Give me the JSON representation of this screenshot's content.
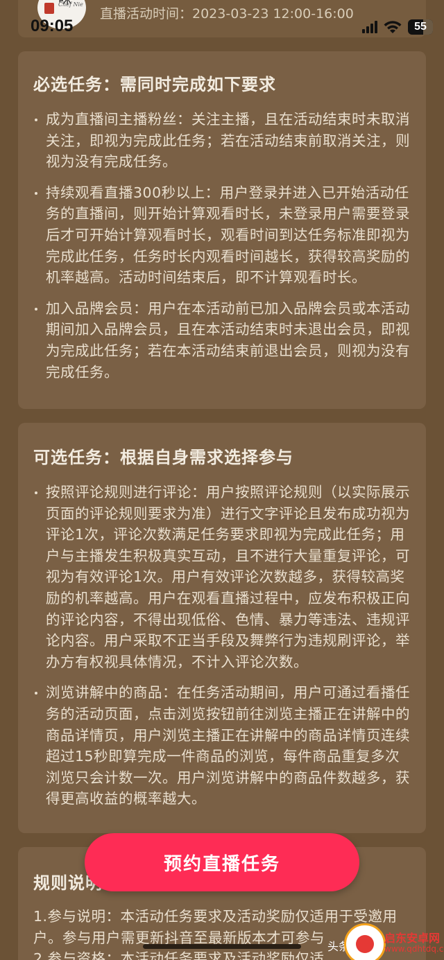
{
  "status_bar": {
    "time": "09:05",
    "battery": "55"
  },
  "header": {
    "avatar_logo_text": "Chef Nie",
    "live_time": "直播活动时间：2023-03-23 12:00-16:00"
  },
  "sections": [
    {
      "title": "必选任务：需同时完成如下要求",
      "items": [
        "成为直播间主播粉丝：关注主播，且在活动结束时未取消关注，即视为完成此任务；若在活动结束前取消关注，则视为没有完成任务。",
        "持续观看直播300秒以上：用户登录并进入已开始活动任务的直播间，则开始计算观看时长，未登录用户需要登录后才可开始计算观看时长，观看时间到达任务标准即视为完成此任务，任务时长内观看时间越长，获得较高奖励的机率越高。活动时间结束后，即不计算观看时长。",
        "加入品牌会员：用户在本活动前已加入品牌会员或本活动期间加入品牌会员，且在本活动结束时未退出会员，即视为完成此任务；若在本活动结束前退出会员，则视为没有完成任务。"
      ]
    },
    {
      "title": "可选任务：根据自身需求选择参与",
      "items": [
        "按照评论规则进行评论：用户按照评论规则（以实际展示页面的评论规则要求为准）进行文字评论且发布成功视为评论1次，评论次数满足任务要求即视为完成此任务；用户与主播发生积极真实互动，且不进行大量重复评论，可视为有效评论1次。用户有效评论次数越多，获得较高奖励的机率越高。用户在观看直播过程中，应发布积极正向的评论内容，不得出现低俗、色情、暴力等违法、违规评论内容。用户采取不正当手段及舞弊行为违规刷评论，举办方有权视具体情况，不计入评论次数。",
        "浏览讲解中的商品：在任务活动期间，用户可通过看播任务的活动页面，点击浏览按钮前往浏览主播正在讲解中的商品详情页，用户浏览主播正在讲解中的商品详情页连续超过15秒即算完成一件商品的浏览，每件商品重复多次浏览只会计数一次。用户浏览讲解中的商品件数越多，获得更高收益的概率越大。"
      ]
    },
    {
      "title": "规则说明",
      "rules": [
        "1.参与说明：本活动任务要求及活动奖励仅适用于受邀用户。参与用户需更新抖音至最新版本才可参与",
        "2.参与资格：本活动任务要求及活动奖励仅适"
      ]
    }
  ],
  "reserve_button_label": "预约直播任务",
  "watermark": {
    "source": "头条 @",
    "site": "启东安卓网",
    "url": "www.qdhtdq.com"
  }
}
